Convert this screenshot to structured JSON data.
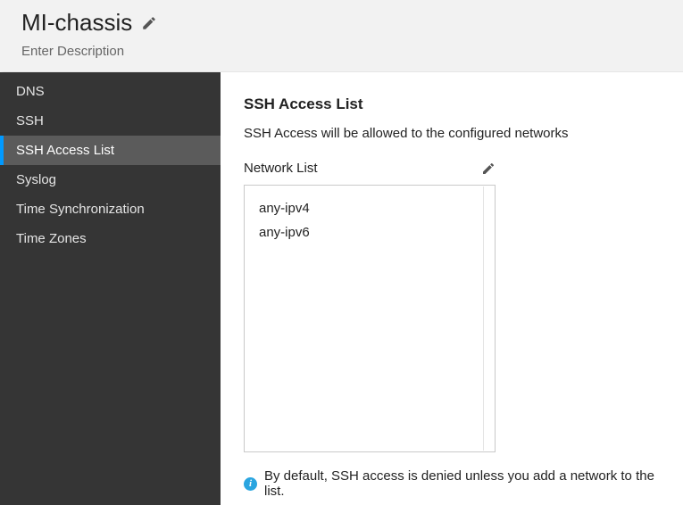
{
  "header": {
    "title": "MI-chassis",
    "subtitle": "Enter Description"
  },
  "sidebar": {
    "items": [
      {
        "label": "DNS",
        "active": false
      },
      {
        "label": "SSH",
        "active": false
      },
      {
        "label": "SSH Access List",
        "active": true
      },
      {
        "label": "Syslog",
        "active": false
      },
      {
        "label": "Time Synchronization",
        "active": false
      },
      {
        "label": "Time Zones",
        "active": false
      }
    ]
  },
  "main": {
    "section_title": "SSH Access List",
    "section_desc": "SSH Access will be allowed to the configured networks",
    "list_label": "Network List",
    "network_list": [
      "any-ipv4",
      "any-ipv6"
    ],
    "info_text": "By default, SSH access is denied unless you add a network to the list."
  }
}
